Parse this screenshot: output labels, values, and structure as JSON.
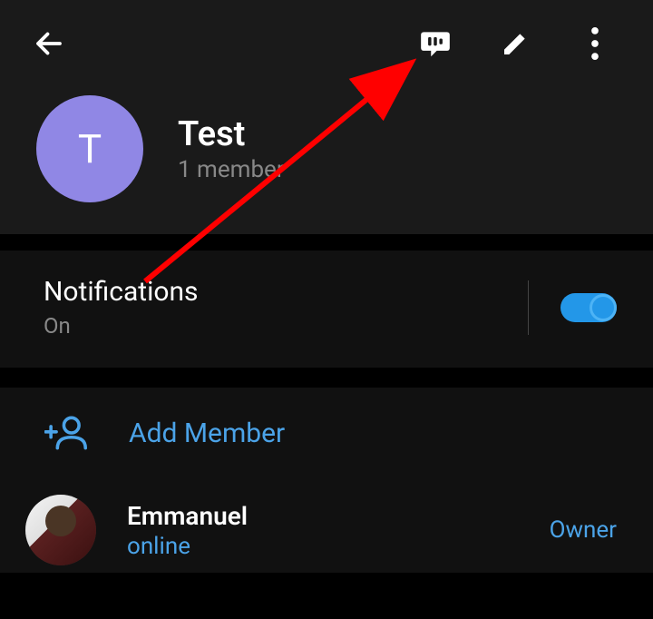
{
  "toolbar": {
    "back": "back",
    "voice_chat": "voice-chat",
    "edit": "edit",
    "more": "more"
  },
  "group": {
    "avatar_letter": "T",
    "name": "Test",
    "member_count_text": "1 member"
  },
  "notifications": {
    "label": "Notifications",
    "value": "On",
    "enabled": true
  },
  "add_member": {
    "label": "Add Member"
  },
  "members": [
    {
      "name": "Emmanuel",
      "status": "online",
      "role": "Owner"
    }
  ],
  "colors": {
    "accent": "#4ba3e8",
    "avatar_bg": "#9087e5"
  }
}
